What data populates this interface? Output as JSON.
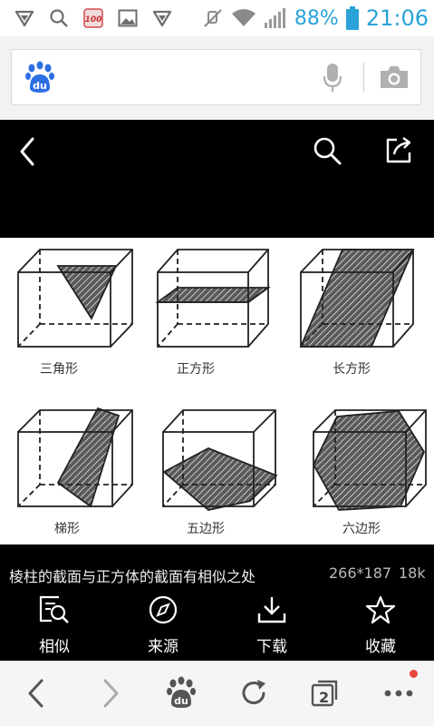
{
  "status_bar": {
    "battery_percent": "88%",
    "time": "21:06",
    "icons": [
      "vpn-shield-icon",
      "search-icon",
      "app-100-icon",
      "image-icon",
      "vpn-shield-icon",
      "mute-icon",
      "wifi-icon",
      "signal-icon",
      "battery-icon"
    ]
  },
  "search_bar": {
    "logo_text": "du",
    "icons": [
      "baidu-paw-icon",
      "microphone-icon",
      "camera-icon"
    ]
  },
  "viewer_toolbar": {
    "icons": [
      "back-icon",
      "search-icon",
      "share-icon"
    ]
  },
  "image": {
    "labels": [
      "三角形",
      "正方形",
      "长方形",
      "梯形",
      "五边形",
      "六边形"
    ]
  },
  "caption": {
    "title": "棱柱的截面与正方体的截面有相似之处",
    "dimensions": "266*187",
    "size": "18k"
  },
  "actions": [
    {
      "label": "相似",
      "icon": "similar-search-icon"
    },
    {
      "label": "来源",
      "icon": "compass-icon"
    },
    {
      "label": "下载",
      "icon": "download-icon"
    },
    {
      "label": "收藏",
      "icon": "star-icon"
    }
  ],
  "nav": {
    "tab_count": "2",
    "logo_text": "du",
    "icons": [
      "back-icon",
      "forward-icon",
      "baidu-home-icon",
      "refresh-icon",
      "tabs-icon",
      "more-icon"
    ],
    "accent_color": "#e8493d"
  }
}
